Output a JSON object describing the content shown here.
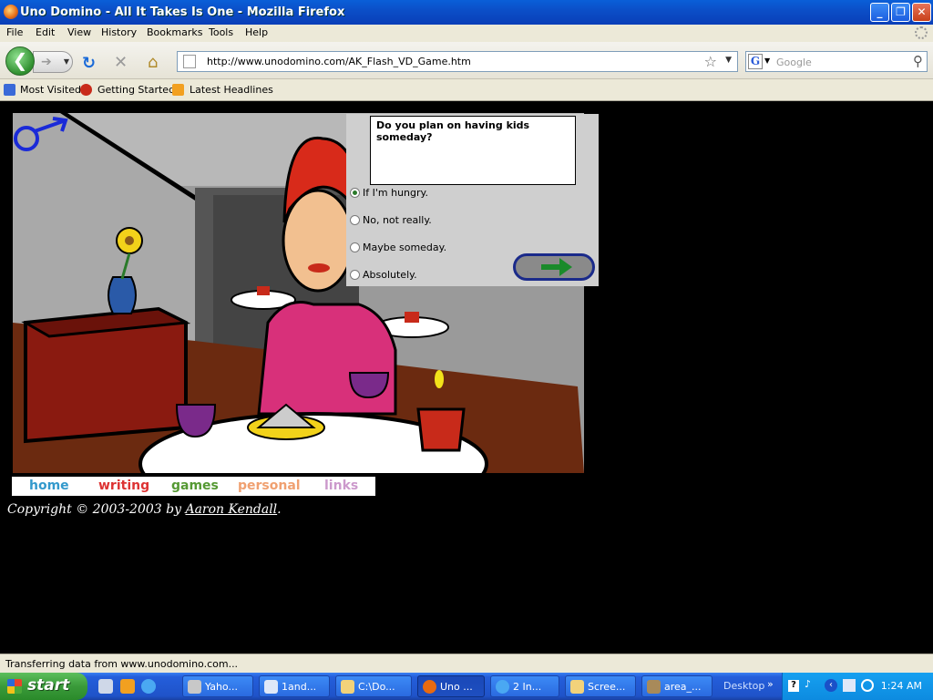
{
  "window": {
    "title": "Uno Domino - All It Takes Is One - Mozilla Firefox",
    "controls": [
      "minimize",
      "maximize",
      "close"
    ]
  },
  "menu": [
    "File",
    "Edit",
    "View",
    "History",
    "Bookmarks",
    "Tools",
    "Help"
  ],
  "toolbar": {
    "url": "http://www.unodomino.com/AK_Flash_VD_Game.htm",
    "search_placeholder": "Google"
  },
  "bookmarks": [
    "Most Visited",
    "Getting Started",
    "Latest Headlines"
  ],
  "game": {
    "question": "Do you plan on having kids someday?",
    "answers": [
      {
        "label": "If I'm hungry.",
        "selected": true
      },
      {
        "label": "No, not really.",
        "selected": false
      },
      {
        "label": "Maybe someday.",
        "selected": false
      },
      {
        "label": "Absolutely.",
        "selected": false
      }
    ],
    "next_icon": "right-arrow-icon"
  },
  "site_nav": {
    "items": [
      {
        "label": "home",
        "color": "#3399cc"
      },
      {
        "label": "writing",
        "color": "#dd3333"
      },
      {
        "label": "games",
        "color": "#559933"
      },
      {
        "label": "personal",
        "color": "#f0a070"
      },
      {
        "label": "links",
        "color": "#cc99cc"
      }
    ]
  },
  "footer": {
    "copyright_prefix": "Copyright © 2003-2003 by ",
    "author": "Aaron Kendall",
    "suffix": "."
  },
  "status": "Transferring data from www.unodomino.com...",
  "taskbar": {
    "start_label": "start",
    "tasks": [
      "Yaho...",
      "1and...",
      "C:\\Do...",
      "Uno ...",
      "2 In...",
      "Scree...",
      "area_..."
    ],
    "desktop_label": "Desktop",
    "clock": "1:24 AM"
  }
}
